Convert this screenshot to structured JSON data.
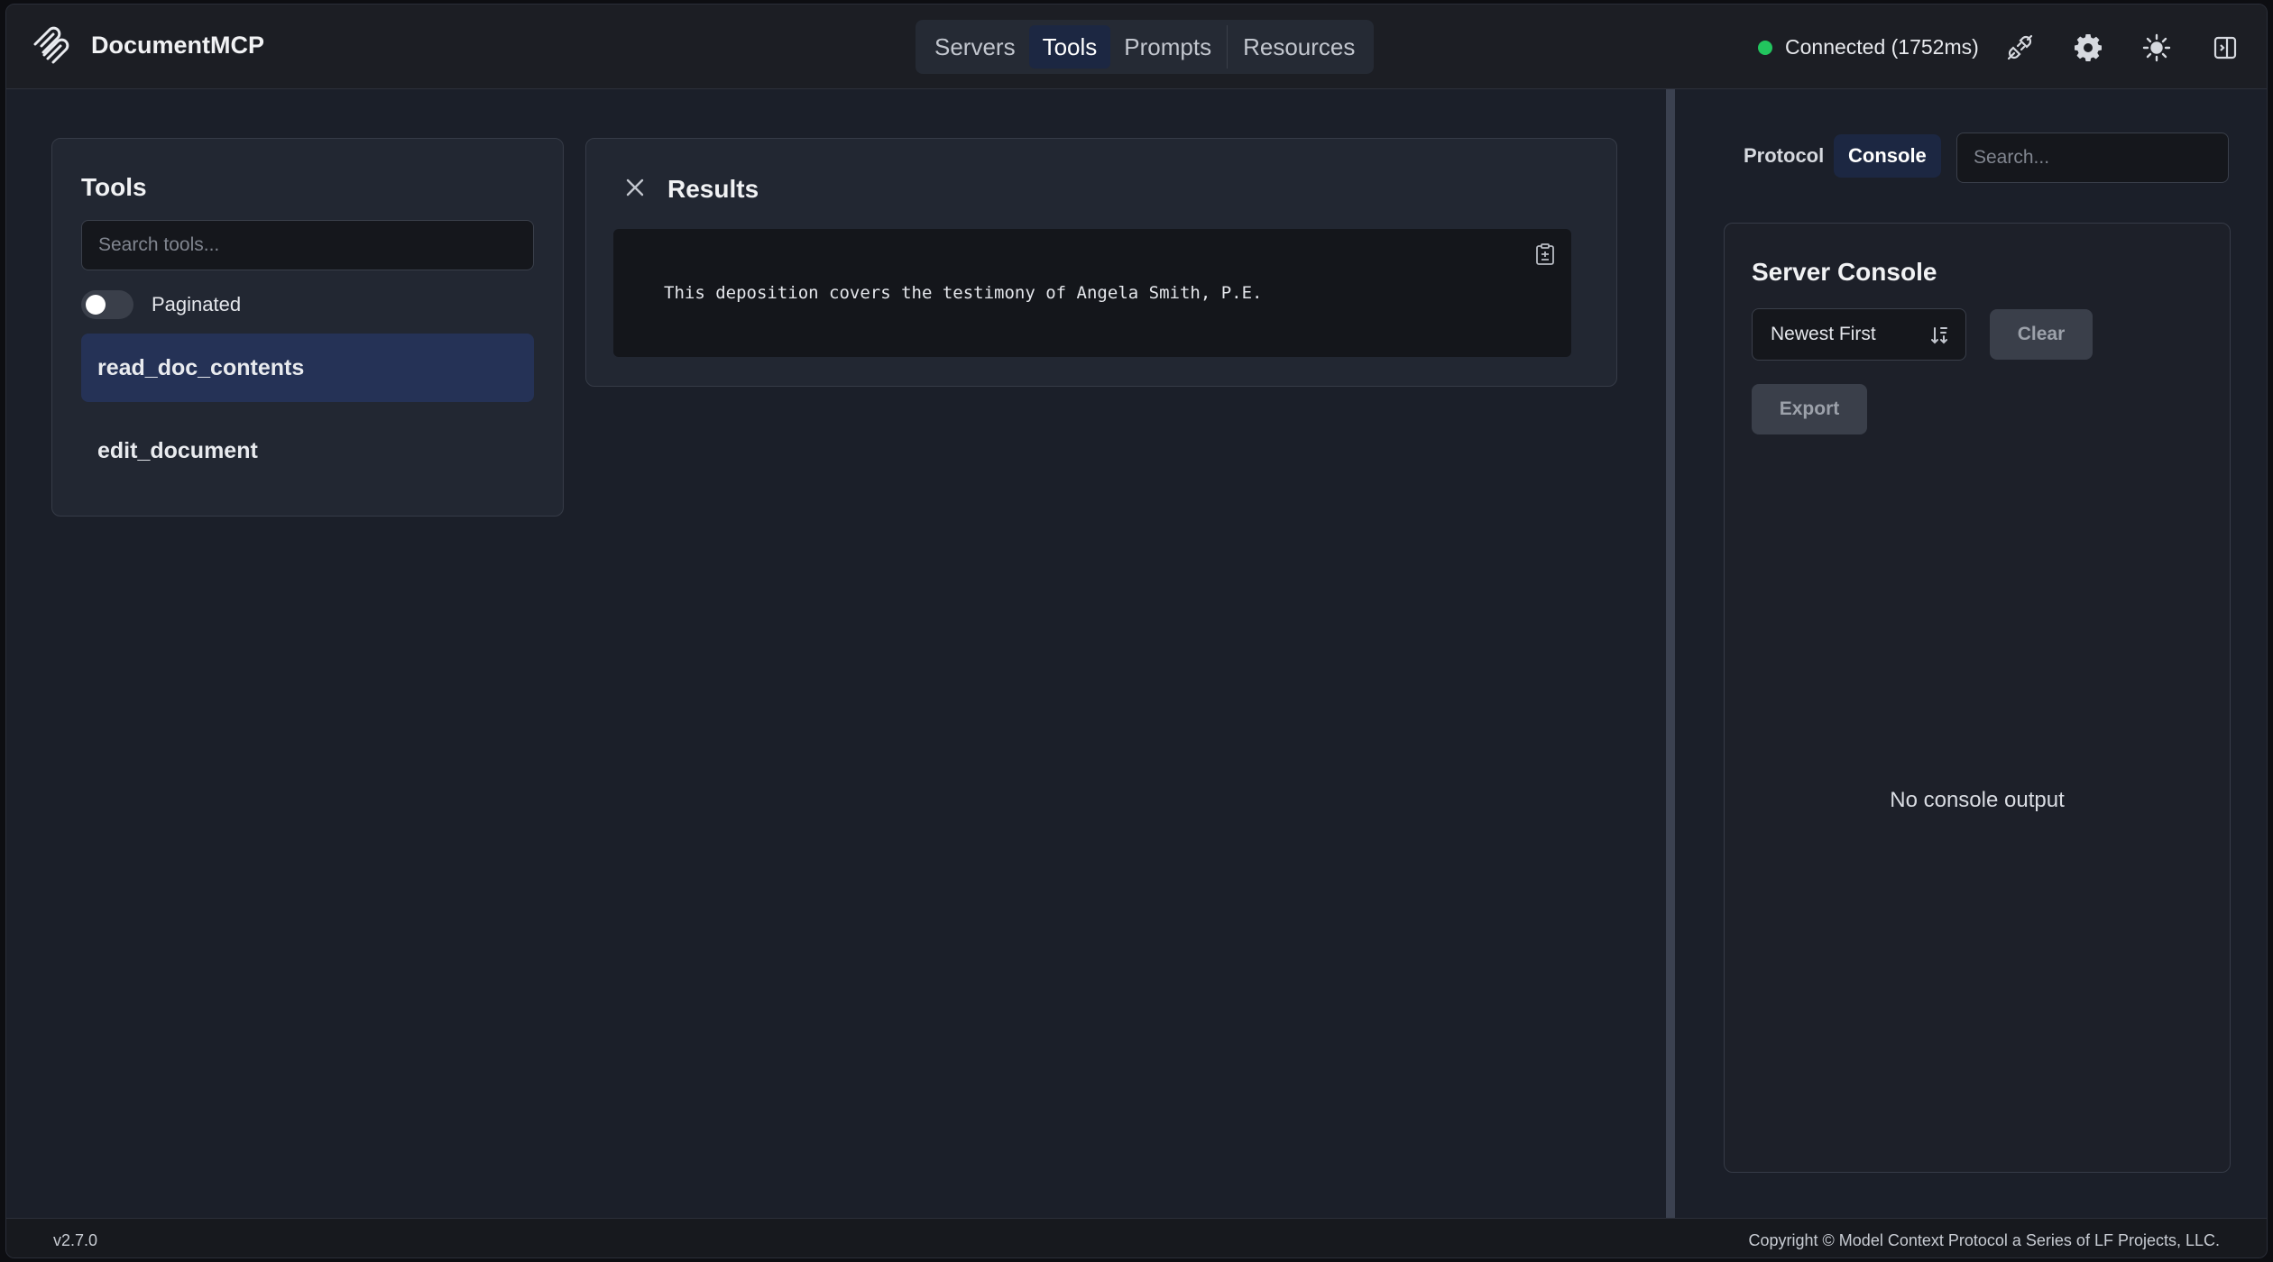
{
  "app": {
    "title": "DocumentMCP"
  },
  "nav": {
    "tabs": [
      "Servers",
      "Tools",
      "Prompts",
      "Resources"
    ],
    "active": "Tools"
  },
  "status": {
    "text": "Connected (1752ms)",
    "color": "#22c55e"
  },
  "header_icons": [
    "plug-icon",
    "gear-icon",
    "sun-icon",
    "panel-toggle-icon"
  ],
  "tools_panel": {
    "title": "Tools",
    "search_placeholder": "Search tools...",
    "toggle_label": "Paginated",
    "items": [
      "read_doc_contents",
      "edit_document"
    ],
    "selected": "read_doc_contents"
  },
  "results": {
    "title": "Results",
    "text": "This deposition covers the testimony of Angela Smith, P.E."
  },
  "right_panel": {
    "tabs": [
      "Protocol",
      "Console"
    ],
    "active_tab": "Console",
    "search_placeholder": "Search...",
    "console": {
      "title": "Server Console",
      "sort_value": "Newest First",
      "clear_label": "Clear",
      "export_label": "Export",
      "empty_message": "No console output"
    }
  },
  "footer": {
    "version": "v2.7.0",
    "copyright": "Copyright © Model Context Protocol a Series of LF Projects, LLC."
  },
  "colors": {
    "accent": "#253256",
    "active_tab": "#1c2742",
    "background": "#1b1f29"
  }
}
